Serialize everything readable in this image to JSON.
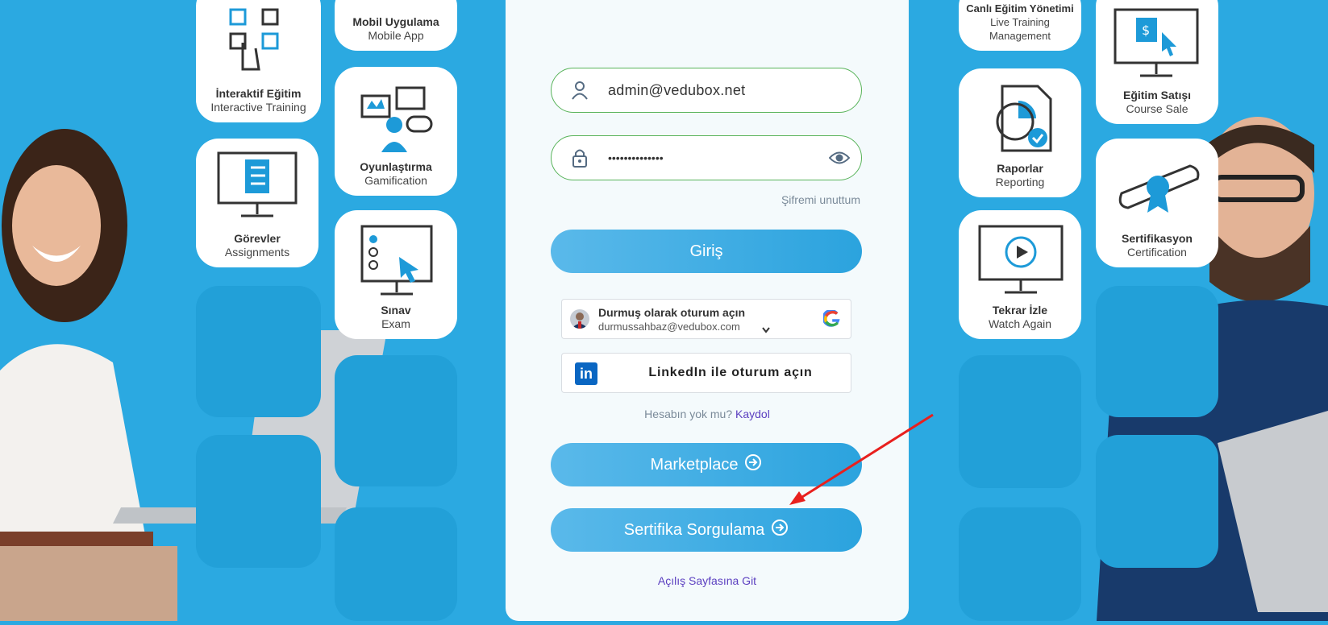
{
  "left_tiles": [
    {
      "title": "İnteraktif Eğitim",
      "subtitle": "Interactive Training",
      "icon": "abcd-touch-icon"
    },
    {
      "title": "Mobil Uygulama",
      "subtitle": "Mobile App",
      "icon": "mobile-icon"
    },
    {
      "title": "Oyunlaştırma",
      "subtitle": "Gamification",
      "icon": "gamification-icon"
    },
    {
      "title": "Görevler",
      "subtitle": "Assignments",
      "icon": "assignments-icon"
    },
    {
      "title": "Sınav",
      "subtitle": "Exam",
      "icon": "exam-icon"
    }
  ],
  "right_tiles": [
    {
      "title": "Canlı Eğitim Yönetimi",
      "subtitle": "Live Training Management",
      "icon": "live-icon"
    },
    {
      "title": "Eğitim Satışı",
      "subtitle": "Course Sale",
      "icon": "course-sale-icon"
    },
    {
      "title": "Raporlar",
      "subtitle": "Reporting",
      "icon": "reporting-icon"
    },
    {
      "title": "Sertifikasyon",
      "subtitle": "Certification",
      "icon": "certificate-icon"
    },
    {
      "title": "Tekrar İzle",
      "subtitle": "Watch Again",
      "icon": "replay-icon"
    }
  ],
  "login": {
    "email_value": "admin@vedubox.net",
    "password_value": "••••••••••••••",
    "forgot_label": "Şifremi unuttum",
    "login_button": "Giriş",
    "google_title": "Durmuş olarak oturum açın",
    "google_email": "durmussahbaz@vedubox.com",
    "linkedin_label": "LinkedIn ile oturum açın",
    "signup_prompt": "Hesabın yok mu?",
    "signup_link": "Kaydol",
    "marketplace_button": "Marketplace",
    "certificate_button": "Sertifika Sorgulama",
    "home_link": "Açılış Sayfasına Git"
  },
  "colors": {
    "background": "#2ba9e1",
    "field_border": "#58b35a",
    "link": "#5b3fc0",
    "annotation_arrow": "#e8201e"
  }
}
